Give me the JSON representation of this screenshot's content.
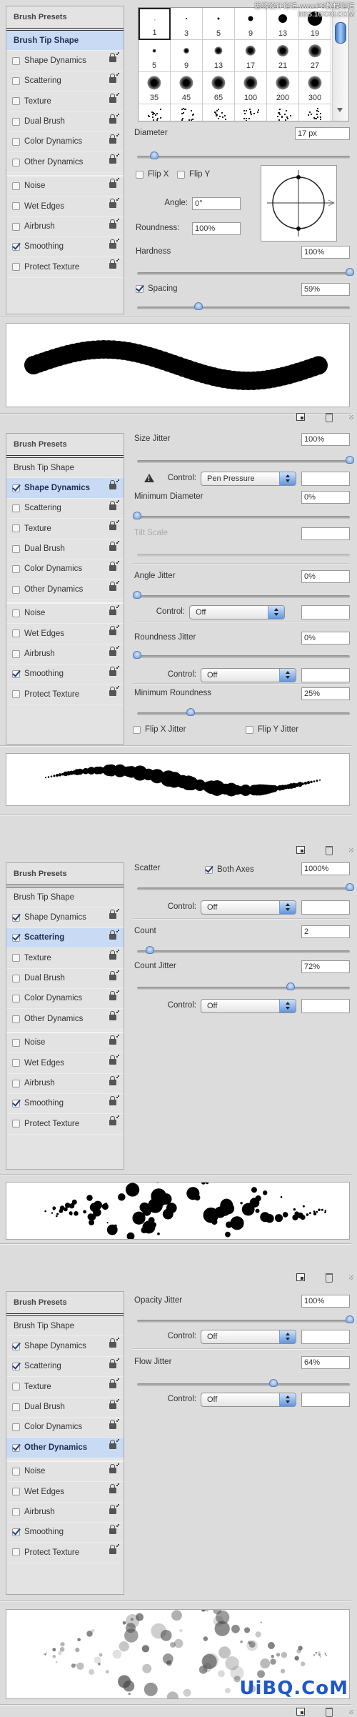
{
  "watermark_top": "思缘设计论坛 www.PS教程论坛 BBS.16XX8.COM",
  "watermark_bottom": "UiBQ.CoM",
  "colors": {
    "selected_row": "#c9dbf4",
    "slider_thumb": "#6d9ad6",
    "panel_bg": "#dcdcdc",
    "watermark": "#1f57c9"
  },
  "panels": [
    {
      "sidebar": {
        "header": "Brush Presets",
        "items": [
          {
            "label": "Brush Tip Shape",
            "checkbox": false,
            "selected": true
          },
          {
            "label": "Shape Dynamics",
            "checkbox": true,
            "checked": false,
            "lock": true
          },
          {
            "label": "Scattering",
            "checkbox": true,
            "checked": false,
            "lock": true
          },
          {
            "label": "Texture",
            "checkbox": true,
            "checked": false,
            "lock": true
          },
          {
            "label": "Dual Brush",
            "checkbox": true,
            "checked": false,
            "lock": true
          },
          {
            "label": "Color Dynamics",
            "checkbox": true,
            "checked": false,
            "lock": true
          },
          {
            "label": "Other Dynamics",
            "checkbox": true,
            "checked": false,
            "lock": true
          },
          {
            "label": "Noise",
            "checkbox": true,
            "checked": false,
            "lock": true
          },
          {
            "label": "Wet Edges",
            "checkbox": true,
            "checked": false,
            "lock": true
          },
          {
            "label": "Airbrush",
            "checkbox": true,
            "checked": false,
            "lock": true
          },
          {
            "label": "Smoothing",
            "checkbox": true,
            "checked": true,
            "lock": true
          },
          {
            "label": "Protect Texture",
            "checkbox": true,
            "checked": false,
            "lock": true
          }
        ]
      },
      "brush_tips": [
        {
          "size": "1",
          "hard": true,
          "selected": true
        },
        {
          "size": "3",
          "hard": true
        },
        {
          "size": "5",
          "hard": true
        },
        {
          "size": "9",
          "hard": true
        },
        {
          "size": "13",
          "hard": true
        },
        {
          "size": "19",
          "hard": true
        },
        {
          "size": "5"
        },
        {
          "size": "9"
        },
        {
          "size": "13"
        },
        {
          "size": "17"
        },
        {
          "size": "21"
        },
        {
          "size": "27"
        },
        {
          "size": "35"
        },
        {
          "size": "45"
        },
        {
          "size": "65"
        },
        {
          "size": "100"
        },
        {
          "size": "200"
        },
        {
          "size": "300"
        }
      ],
      "diameter": {
        "label": "Diameter",
        "value": "17 px",
        "slider_level": 8
      },
      "flip_x": {
        "label": "Flip X",
        "checked": false
      },
      "flip_y": {
        "label": "Flip Y",
        "checked": false
      },
      "angle": {
        "label": "Angle:",
        "value": "0°"
      },
      "roundness": {
        "label": "Roundness:",
        "value": "100%"
      },
      "hardness": {
        "label": "Hardness",
        "value": "100%",
        "slider_level": 100
      },
      "spacing": {
        "label": "Spacing",
        "checked": true,
        "value": "59%",
        "slider_level": 29
      }
    },
    {
      "sidebar": {
        "header": "Brush Presets",
        "items": [
          {
            "label": "Brush Tip Shape",
            "checkbox": false
          },
          {
            "label": "Shape Dynamics",
            "checkbox": true,
            "checked": true,
            "lock": true,
            "selected": true
          },
          {
            "label": "Scattering",
            "checkbox": true,
            "checked": false,
            "lock": true
          },
          {
            "label": "Texture",
            "checkbox": true,
            "checked": false,
            "lock": true
          },
          {
            "label": "Dual Brush",
            "checkbox": true,
            "checked": false,
            "lock": true
          },
          {
            "label": "Color Dynamics",
            "checkbox": true,
            "checked": false,
            "lock": true
          },
          {
            "label": "Other Dynamics",
            "checkbox": true,
            "checked": false,
            "lock": true
          },
          {
            "label": "Noise",
            "checkbox": true,
            "checked": false,
            "lock": true
          },
          {
            "label": "Wet Edges",
            "checkbox": true,
            "checked": false,
            "lock": true
          },
          {
            "label": "Airbrush",
            "checkbox": true,
            "checked": false,
            "lock": true
          },
          {
            "label": "Smoothing",
            "checkbox": true,
            "checked": true,
            "lock": true
          },
          {
            "label": "Protect Texture",
            "checkbox": true,
            "checked": false,
            "lock": true
          }
        ]
      },
      "controls": [
        {
          "type": "field",
          "label": "Size Jitter",
          "value": "100%",
          "slider_level": 100
        },
        {
          "type": "control",
          "label": "Control:",
          "value": "Pen Pressure",
          "warning": true
        },
        {
          "type": "field",
          "label": "Minimum Diameter",
          "value": "0%",
          "slider_level": 0
        },
        {
          "type": "field",
          "label": "Tilt Scale",
          "value": "",
          "disabled": true
        },
        {
          "type": "field",
          "label": "Angle Jitter",
          "value": "0%",
          "slider_level": 0
        },
        {
          "type": "control",
          "label": "Control:",
          "value": "Off"
        },
        {
          "type": "field",
          "label": "Roundness Jitter",
          "value": "0%",
          "slider_level": 0
        },
        {
          "type": "control",
          "label": "Control:",
          "value": "Off"
        },
        {
          "type": "field",
          "label": "Minimum Roundness",
          "value": "25%",
          "slider_level": 25
        },
        {
          "type": "checks",
          "items": [
            {
              "label": "Flip X Jitter",
              "checked": false
            },
            {
              "label": "Flip Y Jitter",
              "checked": false
            }
          ]
        }
      ]
    },
    {
      "sidebar": {
        "header": "Brush Presets",
        "items": [
          {
            "label": "Brush Tip Shape",
            "checkbox": false
          },
          {
            "label": "Shape Dynamics",
            "checkbox": true,
            "checked": true,
            "lock": true
          },
          {
            "label": "Scattering",
            "checkbox": true,
            "checked": true,
            "lock": true,
            "selected": true
          },
          {
            "label": "Texture",
            "checkbox": true,
            "checked": false,
            "lock": true
          },
          {
            "label": "Dual Brush",
            "checkbox": true,
            "checked": false,
            "lock": true
          },
          {
            "label": "Color Dynamics",
            "checkbox": true,
            "checked": false,
            "lock": true
          },
          {
            "label": "Other Dynamics",
            "checkbox": true,
            "checked": false,
            "lock": true
          },
          {
            "label": "Noise",
            "checkbox": true,
            "checked": false,
            "lock": true
          },
          {
            "label": "Wet Edges",
            "checkbox": true,
            "checked": false,
            "lock": true
          },
          {
            "label": "Airbrush",
            "checkbox": true,
            "checked": false,
            "lock": true
          },
          {
            "label": "Smoothing",
            "checkbox": true,
            "checked": true,
            "lock": true
          },
          {
            "label": "Protect Texture",
            "checkbox": true,
            "checked": false,
            "lock": true
          }
        ]
      },
      "controls": [
        {
          "type": "field",
          "label": "Scatter",
          "value": "1000%",
          "slider_level": 100,
          "extra_check": {
            "label": "Both Axes",
            "checked": true
          }
        },
        {
          "type": "control",
          "label": "Control:",
          "value": "Off"
        },
        {
          "type": "field",
          "label": "Count",
          "value": "2",
          "slider_level": 6
        },
        {
          "type": "field",
          "label": "Count Jitter",
          "value": "72%",
          "slider_level": 72
        },
        {
          "type": "control",
          "label": "Control:",
          "value": "Off"
        }
      ]
    },
    {
      "sidebar": {
        "header": "Brush Presets",
        "items": [
          {
            "label": "Brush Tip Shape",
            "checkbox": false
          },
          {
            "label": "Shape Dynamics",
            "checkbox": true,
            "checked": true,
            "lock": true
          },
          {
            "label": "Scattering",
            "checkbox": true,
            "checked": true,
            "lock": true
          },
          {
            "label": "Texture",
            "checkbox": true,
            "checked": false,
            "lock": true
          },
          {
            "label": "Dual Brush",
            "checkbox": true,
            "checked": false,
            "lock": true
          },
          {
            "label": "Color Dynamics",
            "checkbox": true,
            "checked": false,
            "lock": true
          },
          {
            "label": "Other Dynamics",
            "checkbox": true,
            "checked": true,
            "lock": true,
            "selected": true
          },
          {
            "label": "Noise",
            "checkbox": true,
            "checked": false,
            "lock": true
          },
          {
            "label": "Wet Edges",
            "checkbox": true,
            "checked": false,
            "lock": true
          },
          {
            "label": "Airbrush",
            "checkbox": true,
            "checked": false,
            "lock": true
          },
          {
            "label": "Smoothing",
            "checkbox": true,
            "checked": true,
            "lock": true
          },
          {
            "label": "Protect Texture",
            "checkbox": true,
            "checked": false,
            "lock": true
          }
        ]
      },
      "controls": [
        {
          "type": "field",
          "label": "Opacity Jitter",
          "value": "100%",
          "slider_level": 100
        },
        {
          "type": "control",
          "label": "Control:",
          "value": "Off"
        },
        {
          "type": "field",
          "label": "Flow Jitter",
          "value": "64%",
          "slider_level": 64
        },
        {
          "type": "control",
          "label": "Control:",
          "value": "Off"
        }
      ]
    }
  ]
}
